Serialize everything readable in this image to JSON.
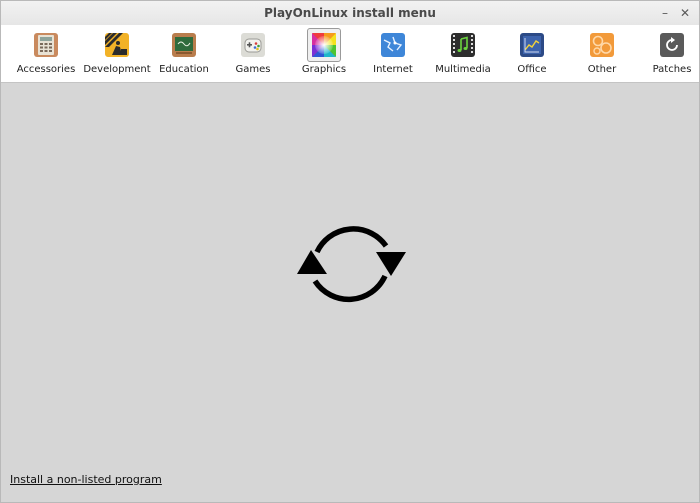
{
  "window": {
    "title": "PlayOnLinux install menu",
    "minimize_glyph": "–",
    "close_glyph": "✕"
  },
  "categories": [
    {
      "label": "Accessories",
      "icon": "calculator-icon"
    },
    {
      "label": "Development",
      "icon": "construction-sign-icon"
    },
    {
      "label": "Education",
      "icon": "chalkboard-icon"
    },
    {
      "label": "Games",
      "icon": "gamepad-icon"
    },
    {
      "label": "Graphics",
      "icon": "color-palette-icon",
      "selected": true
    },
    {
      "label": "Internet",
      "icon": "globe-icon"
    },
    {
      "label": "Multimedia",
      "icon": "film-music-icon"
    },
    {
      "label": "Office",
      "icon": "chart-document-icon"
    },
    {
      "label": "Other",
      "icon": "gears-icon"
    },
    {
      "label": "Patches",
      "icon": "refresh-patch-icon"
    }
  ],
  "content": {
    "loading_icon": "loading-refresh-icon"
  },
  "footer": {
    "install_link": "Install a non-listed program"
  }
}
